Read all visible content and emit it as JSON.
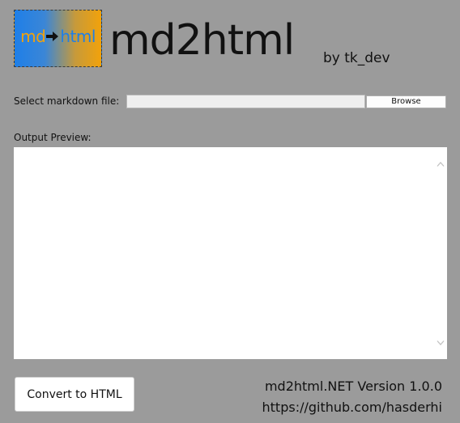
{
  "header": {
    "logo": {
      "left_text": "md",
      "right_text": "html",
      "arrow_icon": "right-arrow-icon",
      "gradient_start": "#1f7fe8",
      "gradient_end": "#f2a20b"
    },
    "title": "md2html",
    "byline": "by tk_dev"
  },
  "file_select": {
    "label": "Select markdown file:",
    "value": "",
    "placeholder": "",
    "browse_label": "Browse"
  },
  "preview": {
    "label": "Output Preview:",
    "content": "",
    "scroll_up_icon": "chevron-up-icon",
    "scroll_down_icon": "chevron-down-icon"
  },
  "footer": {
    "convert_label": "Convert to HTML",
    "version": "md2html.NET Version 1.0.0",
    "repo_url": "https://github.com/hasderhi"
  },
  "colors": {
    "window_background": "#9b9b9b",
    "preview_background": "#ffffff",
    "button_background": "#ffffff"
  }
}
